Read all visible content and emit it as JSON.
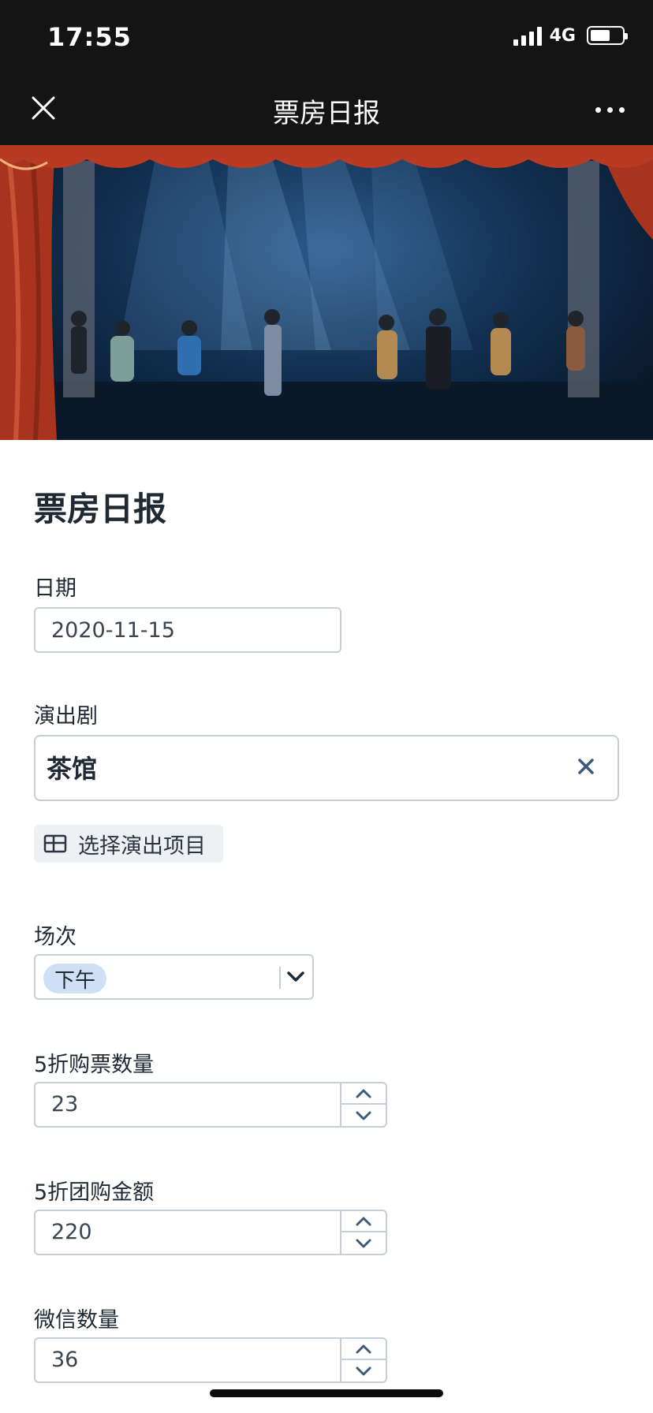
{
  "status_bar": {
    "time": "17:55",
    "network": "4G"
  },
  "nav": {
    "title": "票房日报",
    "close_icon": "close-icon",
    "more_icon": "more-dots-icon"
  },
  "banner": {
    "image": "theater-stage-photo"
  },
  "form": {
    "title": "票房日报",
    "date": {
      "label": "日期",
      "value": "2020-11-15"
    },
    "show": {
      "label": "演出剧",
      "value": "茶馆",
      "clear_icon": "close-icon"
    },
    "choose_button": {
      "label": "选择演出项目",
      "icon": "table-grid-icon"
    },
    "session": {
      "label": "场次",
      "value": "下午",
      "icon": "chevron-down-icon"
    },
    "half_price_tickets": {
      "label": "5折购票数量",
      "value": "23"
    },
    "half_price_group_amount": {
      "label": "5折团购金额",
      "value": "220"
    },
    "wechat_count": {
      "label": "微信数量",
      "value": "36"
    }
  },
  "colors": {
    "topbar": "#141414",
    "tag_bg": "#cfdff5",
    "border": "#c7ced6",
    "button_bg": "#eef1f4"
  }
}
